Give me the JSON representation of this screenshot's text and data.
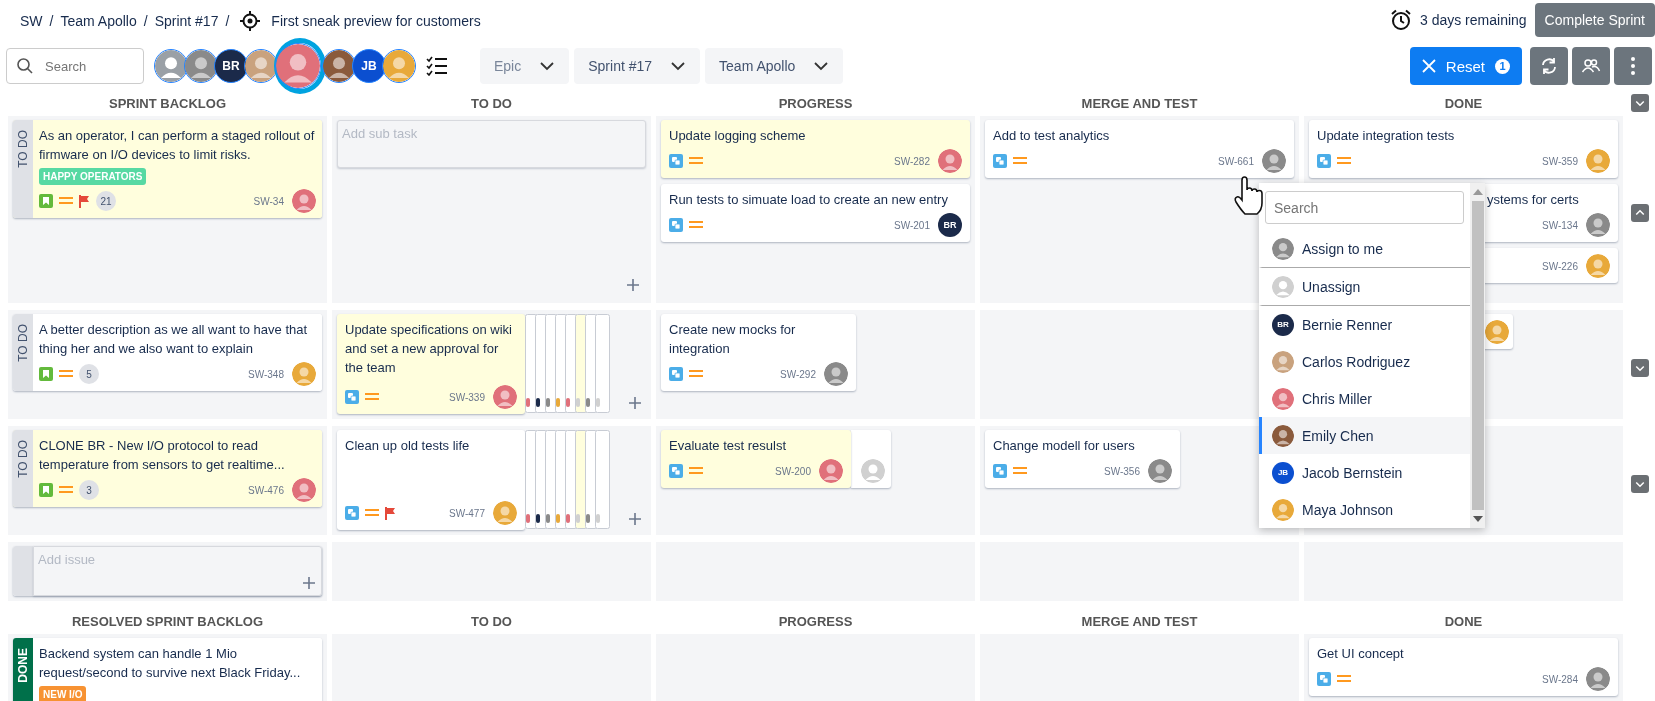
{
  "breadcrumb": {
    "items": [
      "SW",
      "Team Apollo",
      "Sprint #17"
    ],
    "separator": "/"
  },
  "sprint_goal": "First sneak preview for customers",
  "remaining": "3 days remaining",
  "complete_button": "Complete Sprint",
  "search": {
    "placeholder": "Search"
  },
  "people_filter": [
    {
      "kind": "unassigned",
      "color": "#9aa0a6",
      "selected": false
    },
    {
      "kind": "photo",
      "color": "#8a8a8a",
      "selected": false
    },
    {
      "kind": "initials",
      "initials": "BR",
      "color": "#1b2a4a",
      "selected": false
    },
    {
      "kind": "photo",
      "color": "#c9a27e",
      "selected": false
    },
    {
      "kind": "photo",
      "color": "#e0707a",
      "selected": true
    },
    {
      "kind": "photo",
      "color": "#8a5a3c",
      "selected": false
    },
    {
      "kind": "initials",
      "initials": "JB",
      "color": "#0b4fd0",
      "selected": false
    },
    {
      "kind": "photo",
      "color": "#e8a93a",
      "selected": false
    }
  ],
  "filters": [
    {
      "text": "Epic",
      "placeholder": true
    },
    {
      "text": "Sprint #17",
      "placeholder": false
    },
    {
      "text": "Team Apollo",
      "placeholder": false
    }
  ],
  "reset_button": {
    "label": "Reset",
    "badge": "1"
  },
  "columns": [
    "SPRINT BACKLOG",
    "TO DO",
    "PROGRESS",
    "MERGE AND TEST",
    "DONE"
  ],
  "header_toggle": {
    "expanded": false
  },
  "lanes": [
    {
      "status": "TO DO",
      "kind": "todo",
      "expanded": true,
      "story": {
        "title": "As an operator, I can perform a staged rollout of firmware on I/O devices to limit risks.",
        "key": "SW-34",
        "kind": "story",
        "highlighted": true,
        "flagged": true,
        "label": {
          "text": "HAPPY OPERATORS",
          "color": "#57d9a3"
        },
        "count": "21",
        "assignee": {
          "kind": "photo",
          "color": "#e0707a"
        }
      },
      "cells": [
        {
          "add_placeholder": "Add sub task"
        },
        {
          "cards": [
            {
              "title": "Update logging scheme",
              "key": "SW-282",
              "kind": "subtask",
              "highlighted": true,
              "flagged": false,
              "assignee": {
                "kind": "photo",
                "color": "#e0707a"
              }
            },
            {
              "title": "Run tests to simuate load to create an new entry",
              "key": "SW-201",
              "kind": "subtask",
              "highlighted": false,
              "flagged": false,
              "assignee": {
                "kind": "initials",
                "initials": "BR",
                "color": "#1b2a4a"
              }
            }
          ]
        },
        {
          "cards": [
            {
              "title": "Add to test analytics",
              "key": "SW-661",
              "kind": "subtask",
              "highlighted": false,
              "flagged": false,
              "assignee": {
                "kind": "photo",
                "color": "#8a8a8a"
              }
            }
          ]
        },
        {
          "cards": [
            {
              "title": "Update integration tests",
              "key": "SW-359",
              "kind": "subtask",
              "highlighted": false,
              "flagged": false,
              "assignee": {
                "kind": "photo",
                "color": "#e8a93a"
              }
            },
            {
              "title": "ystems for certs",
              "key": "SW-134",
              "highlighted": false,
              "covered": true,
              "assignee": {
                "kind": "photo",
                "color": "#8a8a8a"
              }
            },
            {
              "key": "SW-226",
              "highlighted": false,
              "covered": true,
              "assignee": {
                "kind": "photo",
                "color": "#e8a93a"
              }
            }
          ]
        }
      ]
    },
    {
      "status": "TO DO",
      "kind": "todo",
      "expanded": false,
      "story": {
        "title": "A better description as we all want to have that thing her and we also want to explain",
        "key": "SW-348",
        "kind": "story",
        "highlighted": false,
        "flagged": false,
        "count": "5",
        "assignee": {
          "kind": "photo",
          "color": "#e8a93a"
        }
      },
      "cells": [
        {
          "kind": "fan",
          "add_button": true,
          "cards": [
            {
              "title": "Update specifications on wiki and set a new approval for the team",
              "key": "SW-339",
              "kind": "subtask",
              "highlighted": true,
              "flagged": false,
              "assignee": {
                "kind": "photo",
                "color": "#e0707a"
              }
            }
          ]
        },
        {
          "cards": [
            {
              "title": "Create new mocks for integration",
              "key": "SW-292",
              "kind": "subtask",
              "highlighted": false,
              "flagged": false,
              "assignee": {
                "kind": "photo",
                "color": "#8a8a8a"
              }
            }
          ]
        },
        {},
        {
          "cards": [
            {
              "highlighted": false,
              "covered": true,
              "assignee": {
                "kind": "photo",
                "color": "#e8a93a"
              }
            }
          ]
        }
      ]
    },
    {
      "status": "TO DO",
      "kind": "todo",
      "expanded": false,
      "story": {
        "title": "CLONE BR - New I/O protocol to read temperature from sensors to get realtime...",
        "key": "SW-476",
        "kind": "story",
        "highlighted": true,
        "flagged": false,
        "count": "3",
        "assignee": {
          "kind": "photo",
          "color": "#e0707a"
        }
      },
      "cells": [
        {
          "kind": "fan",
          "add_button": true,
          "cards": [
            {
              "title": "Clean up old tests life",
              "key": "SW-477",
              "kind": "subtask",
              "highlighted": false,
              "flagged": true,
              "assignee": {
                "kind": "photo",
                "color": "#e8a93a"
              }
            }
          ]
        },
        {
          "kind": "overlap",
          "behind": {
            "assignee": {
              "kind": "unassigned",
              "color": "#d0d0d0"
            }
          },
          "cards": [
            {
              "title": "Evaluate test resulst",
              "key": "SW-200",
              "kind": "subtask",
              "highlighted": true,
              "flagged": false,
              "assignee": {
                "kind": "photo",
                "color": "#e0707a"
              }
            }
          ]
        },
        {
          "cards": [
            {
              "title": "Change modell for users",
              "key": "SW-356",
              "kind": "subtask",
              "highlighted": false,
              "flagged": false,
              "assignee": {
                "kind": "photo",
                "color": "#8a8a8a"
              }
            }
          ]
        },
        {}
      ]
    }
  ],
  "add_issue": {
    "placeholder": "Add issue"
  },
  "resolved_columns": [
    "RESOLVED SPRINT BACKLOG",
    "TO DO",
    "PROGRESS",
    "MERGE AND TEST",
    "DONE"
  ],
  "resolved_lanes": [
    {
      "status": "DONE",
      "kind": "done",
      "story": {
        "title": "Backend system can handle 1 Mio request/second to survive next Black Friday...",
        "highlighted": false,
        "label": {
          "text": "NEW I/O",
          "color": "#f79232"
        }
      },
      "cells": [
        {},
        {},
        {},
        {
          "cards": [
            {
              "title": "Get UI concept",
              "key": "SW-284",
              "kind": "subtask",
              "highlighted": false,
              "flagged": false,
              "assignee": {
                "kind": "photo",
                "color": "#8a8a8a"
              }
            }
          ]
        }
      ]
    }
  ],
  "assignee_menu": {
    "search_placeholder": "Search",
    "items": [
      {
        "text": "Assign to me",
        "avatar": {
          "kind": "photo",
          "color": "#8a8a8a"
        },
        "divider": true,
        "selected": false
      },
      {
        "text": "Unassign",
        "avatar": {
          "kind": "unassigned",
          "color": "#d0d0d0"
        },
        "divider": true,
        "selected": false
      },
      {
        "text": "Bernie Renner",
        "avatar": {
          "kind": "initials",
          "initials": "BR",
          "color": "#1b2a4a"
        },
        "divider": false,
        "selected": false
      },
      {
        "text": "Carlos Rodriguez",
        "avatar": {
          "kind": "photo",
          "color": "#c9a27e"
        },
        "divider": false,
        "selected": false
      },
      {
        "text": "Chris Miller",
        "avatar": {
          "kind": "photo",
          "color": "#e0707a"
        },
        "divider": false,
        "selected": false
      },
      {
        "text": "Emily Chen",
        "avatar": {
          "kind": "photo",
          "color": "#8a5a3c"
        },
        "divider": false,
        "selected": true
      },
      {
        "text": "Jacob Bernstein",
        "avatar": {
          "kind": "initials",
          "initials": "JB",
          "color": "#0b4fd0"
        },
        "divider": false,
        "selected": false
      },
      {
        "text": "Maya Johnson",
        "avatar": {
          "kind": "photo",
          "color": "#e8a93a"
        },
        "divider": false,
        "selected": false
      }
    ]
  }
}
